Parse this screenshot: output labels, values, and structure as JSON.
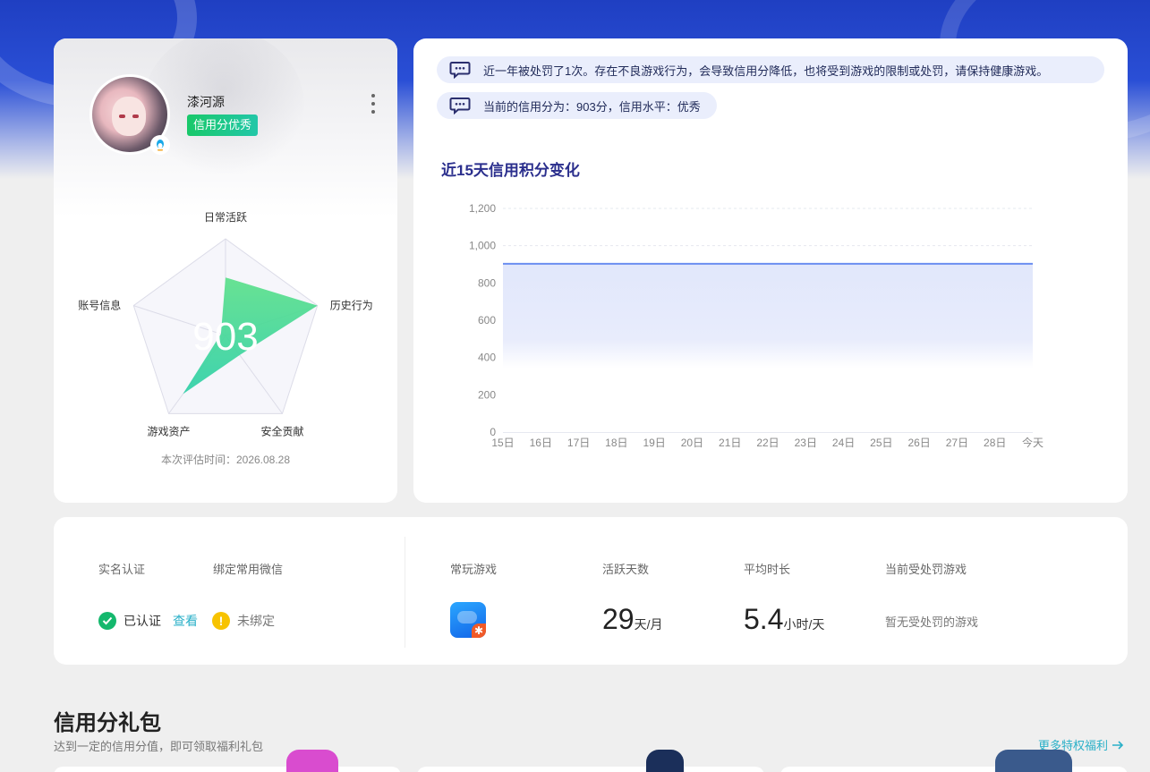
{
  "profile": {
    "username": "漆河源",
    "credit_tag": "信用分优秀",
    "score": "903",
    "radar": {
      "axes": [
        "日常活跃",
        "历史行为",
        "安全贡献",
        "游戏资产",
        "账号信息"
      ],
      "values": [
        0.6,
        1.0,
        0.25,
        0.75,
        0.05
      ]
    },
    "eval_time_label": "本次评估时间：",
    "eval_time": "2026.08.28"
  },
  "notices": {
    "penalty": "近一年被处罚了1次。存在不良游戏行为，会导致信用分降低，也将受到游戏的限制或处罚，请保持健康游戏。",
    "current": "当前的信用分为：903分，信用水平：优秀"
  },
  "chart_data": {
    "type": "area",
    "title": "近15天信用积分变化",
    "categories": [
      "15日",
      "16日",
      "17日",
      "18日",
      "19日",
      "20日",
      "21日",
      "22日",
      "23日",
      "24日",
      "25日",
      "26日",
      "27日",
      "28日",
      "今天"
    ],
    "series": [
      {
        "values": [
          903,
          903,
          903,
          903,
          903,
          903,
          903,
          903,
          903,
          903,
          903,
          903,
          903,
          903,
          903
        ]
      }
    ],
    "ylim": [
      0,
      1200
    ],
    "yticks": [
      "0",
      "200",
      "400",
      "600",
      "800",
      "1,000",
      "1,200"
    ],
    "grid": true,
    "colors": {
      "line": "#6b8ef0",
      "fill": "#e4e9fb"
    }
  },
  "stats": {
    "realname_label": "实名认证",
    "wechat_label": "绑定常用微信",
    "verified_text": "已认证",
    "view_link": "查看",
    "unbound_text": "未绑定",
    "fav_game_label": "常玩游戏",
    "active_days_label": "活跃天数",
    "active_days_value": "29",
    "active_days_unit": "天/月",
    "avg_time_label": "平均时长",
    "avg_time_value": "5.4",
    "avg_time_unit": "小时/天",
    "penalty_game_label": "当前受处罚游戏",
    "penalty_game_value": "暂无受处罚的游戏"
  },
  "gift": {
    "title": "信用分礼包",
    "subtitle": "达到一定的信用分值，即可领取福利礼包",
    "more_link": "更多特权福利"
  },
  "colors": {
    "accent": "#2ab0c8",
    "chart_title": "#2b2f8d",
    "success": "#14b86d",
    "warning": "#f7c300",
    "radar_fill_top": "#5ce08a",
    "radar_fill_bottom": "#2fd0a8"
  }
}
